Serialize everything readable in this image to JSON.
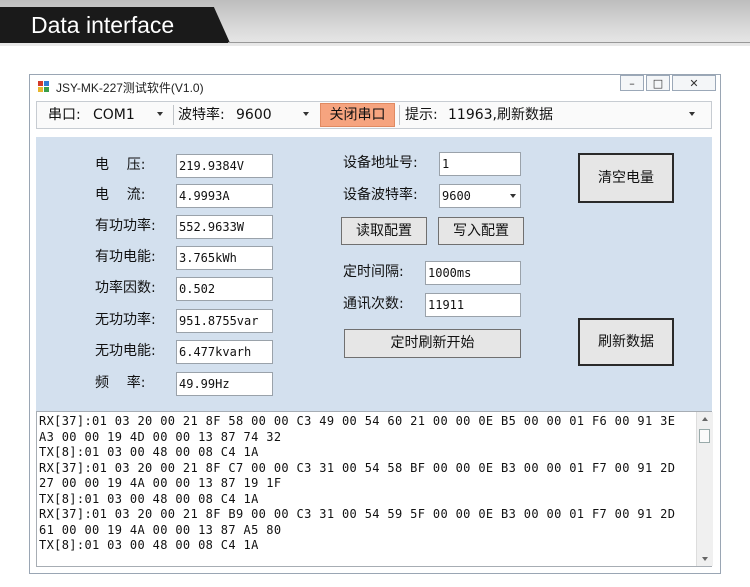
{
  "banner": {
    "title": "Data interface"
  },
  "window": {
    "title": "JSY-MK-227测试软件(V1.0)",
    "controls": {
      "minimize": "–",
      "maximize": "□",
      "close": "✕"
    }
  },
  "toolbar": {
    "port_label": "串口:",
    "port_value": "COM1",
    "baud_label": "波特率:",
    "baud_value": "9600",
    "close_port_label": "关闭串口",
    "hint_label": "提示:",
    "hint_value": "11963,刷新数据"
  },
  "measurements": [
    {
      "label": "电    压:",
      "value": "219.9384V"
    },
    {
      "label": "电    流:",
      "value": "4.9993A"
    },
    {
      "label": "有功功率:",
      "value": "552.9633W"
    },
    {
      "label": "有功电能:",
      "value": "3.765kWh"
    },
    {
      "label": "功率因数:",
      "value": "0.502"
    },
    {
      "label": "无功功率:",
      "value": "951.8755var"
    },
    {
      "label": "无功电能:",
      "value": "6.477kvarh"
    },
    {
      "label": "频    率:",
      "value": "49.99Hz"
    }
  ],
  "config": {
    "device_address_label": "设备地址号:",
    "device_address_value": "1",
    "device_baud_label": "设备波特率:",
    "device_baud_value": "9600",
    "read_config_label": "读取配置",
    "write_config_label": "写入配置",
    "interval_label": "定时间隔:",
    "interval_value": "1000ms",
    "comm_count_label": "通讯次数:",
    "comm_count_value": "11911",
    "timer_refresh_label": "定时刷新开始",
    "clear_energy_label": "清空电量",
    "refresh_data_label": "刷新数据"
  },
  "log": {
    "lines": [
      "RX[37]:01 03 20 00 21 8F 58 00 00 C3 49 00 54 60 21 00 00 0E B5 00 00 01 F6 00 91 3E",
      "A3 00 00 19 4D 00 00 13 87 74 32",
      "TX[8]:01 03 00 48 00 08 C4 1A",
      "RX[37]:01 03 20 00 21 8F C7 00 00 C3 31 00 54 58 BF 00 00 0E B3 00 00 01 F7 00 91 2D",
      "27 00 00 19 4A 00 00 13 87 19 1F",
      "TX[8]:01 03 00 48 00 08 C4 1A",
      "RX[37]:01 03 20 00 21 8F B9 00 00 C3 31 00 54 59 5F 00 00 0E B3 00 00 01 F7 00 91 2D",
      "61 00 00 19 4A 00 00 13 87 A5 80",
      "TX[8]:01 03 00 48 00 08 C4 1A"
    ]
  },
  "colors": {
    "panel": "#d3e0ee",
    "close_port": "#f6a47f",
    "banner_dark": "#1a1a1a"
  }
}
